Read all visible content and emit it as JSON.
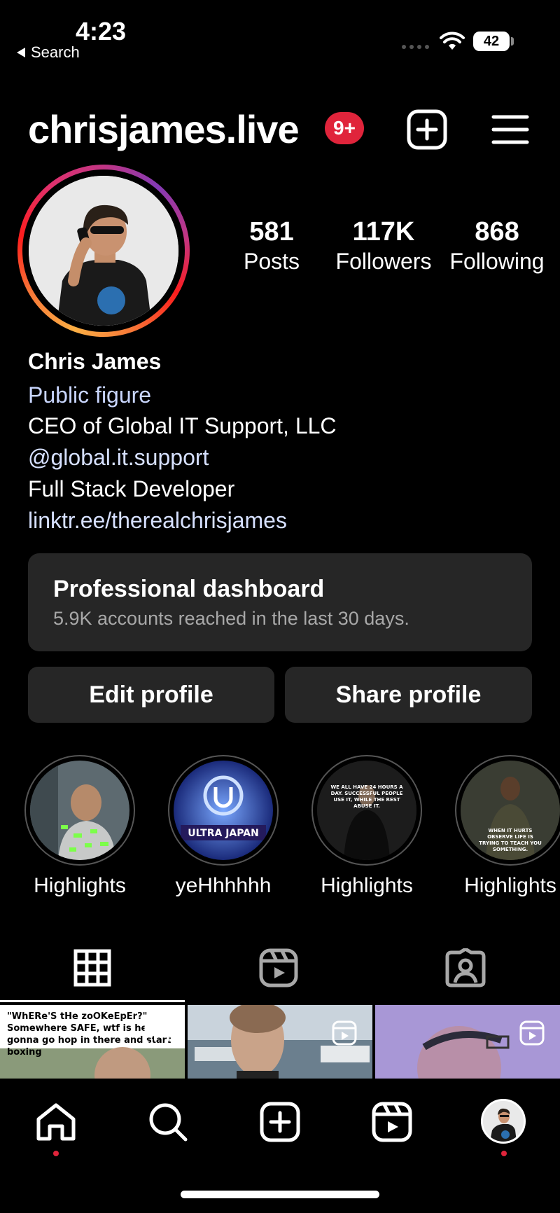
{
  "status_bar": {
    "time": "4:23",
    "back_label": "Search",
    "battery": "42"
  },
  "header": {
    "username": "chrisjames.live",
    "notification_badge": "9+"
  },
  "stats": [
    {
      "value": "581",
      "label": "Posts"
    },
    {
      "value": "117K",
      "label": "Followers"
    },
    {
      "value": "868",
      "label": "Following"
    }
  ],
  "bio": {
    "name": "Chris James",
    "category": "Public figure",
    "line1": "CEO of Global IT Support, LLC",
    "handle": "@global.it.support",
    "line2": "Full Stack Developer",
    "link": "linktr.ee/therealchrisjames"
  },
  "dashboard": {
    "title": "Professional dashboard",
    "subtitle": "5.9K accounts reached in the last 30 days."
  },
  "actions": {
    "edit": "Edit profile",
    "share": "Share profile"
  },
  "highlights": [
    {
      "label": "Highlights"
    },
    {
      "label": "yeHhhhhh",
      "image_text": "ULTRA JAPAN"
    },
    {
      "label": "Highlights",
      "image_text": "WE ALL HAVE 24 HOURS A DAY. SUCCESSFUL PEOPLE USE IT, WHILE THE REST ABUSE IT."
    },
    {
      "label": "Highlights",
      "image_text": "WHEN IT HURTS OBSERVE LIFE IS TRYING TO TEACH YOU SOMETHING."
    }
  ],
  "tabs": [
    "grid-icon",
    "reels-icon",
    "tagged-icon"
  ],
  "posts": [
    {
      "caption": "\"WhERe'S tHe zoOKeEpEr?\" Somewhere SAFE, wtf is he gonna go hop in there and start boxing"
    },
    {
      "caption": ""
    },
    {
      "caption": ""
    }
  ],
  "bottom_nav": [
    "home-icon",
    "search-icon",
    "create-icon",
    "reels-icon",
    "profile-avatar"
  ],
  "colors": {
    "accent_red": "#e0243b",
    "card_bg": "#262626",
    "link_blue": "#d6e0ff"
  }
}
